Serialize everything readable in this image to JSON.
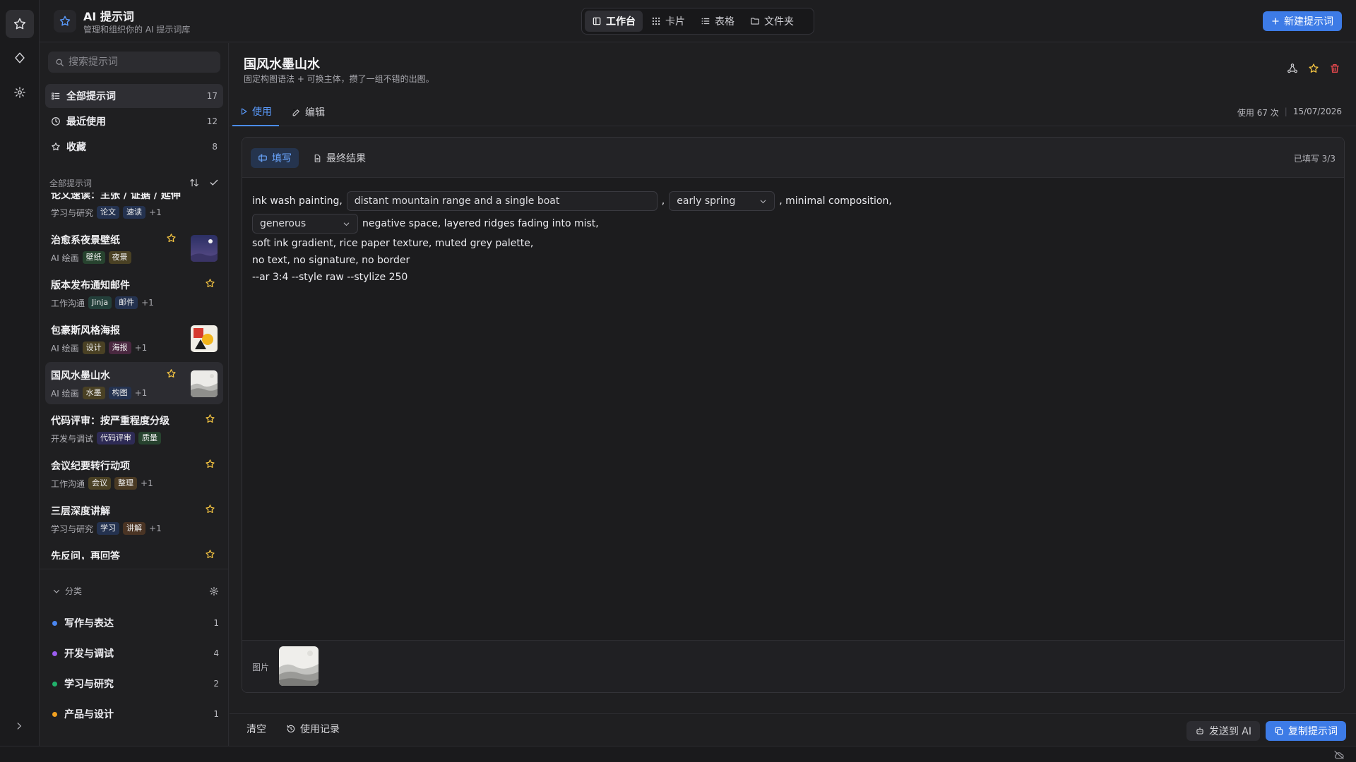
{
  "app": {
    "title": "AI 提示词",
    "subtitle": "管理和组织你的 AI 提示词库"
  },
  "rail": {
    "icons": [
      "star-icon",
      "diamond-icon",
      "gear-icon"
    ]
  },
  "view_switch": [
    {
      "label": "工作台",
      "icon": "layout-icon",
      "active": true
    },
    {
      "label": "卡片",
      "icon": "grid-icon",
      "active": false
    },
    {
      "label": "表格",
      "icon": "list-icon",
      "active": false
    },
    {
      "label": "文件夹",
      "icon": "folder-icon",
      "active": false
    }
  ],
  "new_button": "新建提示词",
  "sidebar": {
    "search_placeholder": "搜索提示词",
    "nav": [
      {
        "label": "全部提示词",
        "count": "17",
        "active": true
      },
      {
        "label": "最近使用",
        "count": "12",
        "active": false
      },
      {
        "label": "收藏",
        "count": "8",
        "active": false
      }
    ],
    "list_header": "全部提示词",
    "prompts": [
      {
        "title": "论文速读：主张 / 证据 / 延伸",
        "category": "学习与研究",
        "tags": [
          "论文",
          "速读"
        ],
        "more": "+1",
        "starred": false
      },
      {
        "title": "治愈系夜景壁纸",
        "category": "AI 绘画",
        "tags": [
          "壁纸",
          "夜景"
        ],
        "more": "",
        "starred": true
      },
      {
        "title": "版本发布通知邮件",
        "category": "工作沟通",
        "tags": [
          "Jinja",
          "邮件"
        ],
        "more": "+1",
        "starred": true
      },
      {
        "title": "包豪斯风格海报",
        "category": "AI 绘画",
        "tags": [
          "设计",
          "海报"
        ],
        "more": "+1",
        "starred": false
      },
      {
        "title": "国风水墨山水",
        "category": "AI 绘画",
        "tags": [
          "水墨",
          "构图"
        ],
        "more": "+1",
        "starred": true
      },
      {
        "title": "代码评审：按严重程度分级",
        "category": "开发与调试",
        "tags": [
          "代码评审",
          "质量"
        ],
        "more": "",
        "starred": true
      },
      {
        "title": "会议纪要转行动项",
        "category": "工作沟通",
        "tags": [
          "会议",
          "整理"
        ],
        "more": "+1",
        "starred": true
      },
      {
        "title": "三层深度讲解",
        "category": "学习与研究",
        "tags": [
          "学习",
          "讲解"
        ],
        "more": "+1",
        "starred": true
      },
      {
        "title": "先反问，再回答",
        "category": "",
        "tags": [],
        "more": "",
        "starred": true
      }
    ],
    "categories_label": "分类",
    "categories": [
      {
        "name": "写作与表达",
        "count": "1",
        "color": "#4a86f0"
      },
      {
        "name": "开发与调试",
        "count": "4",
        "color": "#9b5cf0"
      },
      {
        "name": "学习与研究",
        "count": "2",
        "color": "#21b26b"
      },
      {
        "name": "产品与设计",
        "count": "1",
        "color": "#f0a020"
      }
    ]
  },
  "main": {
    "title": "国风水墨山水",
    "description": "固定构图语法 + 可换主体，攒了一组不错的出图。",
    "tabs": [
      {
        "label": "使用",
        "active": true
      },
      {
        "label": "编辑",
        "active": false
      }
    ],
    "usage_count": "使用 67 次",
    "date": "15/07/2026",
    "panel_tabs": [
      {
        "label": "填写",
        "active": true
      },
      {
        "label": "最终结果",
        "active": false
      }
    ],
    "fill_status": "已填写 3/3",
    "template": {
      "l1_a": "ink wash painting,",
      "field_subject": "distant mountain range and a single boat",
      "l1_comma": ",",
      "field_season": "early spring",
      "l1_b": ", minimal composition,",
      "field_space": "generous",
      "l2": "negative space, layered ridges fading into mist,",
      "l3": "soft ink gradient, rice paper texture, muted grey palette,",
      "l4": "no text, no signature, no border",
      "l5": "--ar 3:4 --style raw --stylize 250"
    },
    "image_label": "图片"
  },
  "bottom": {
    "clear": "清空",
    "history": "使用记录",
    "send": "发送到 AI",
    "copy": "复制提示词"
  },
  "colors": {
    "accent": "#3d7be6",
    "star": "#f5c542",
    "danger": "#e5484d"
  }
}
